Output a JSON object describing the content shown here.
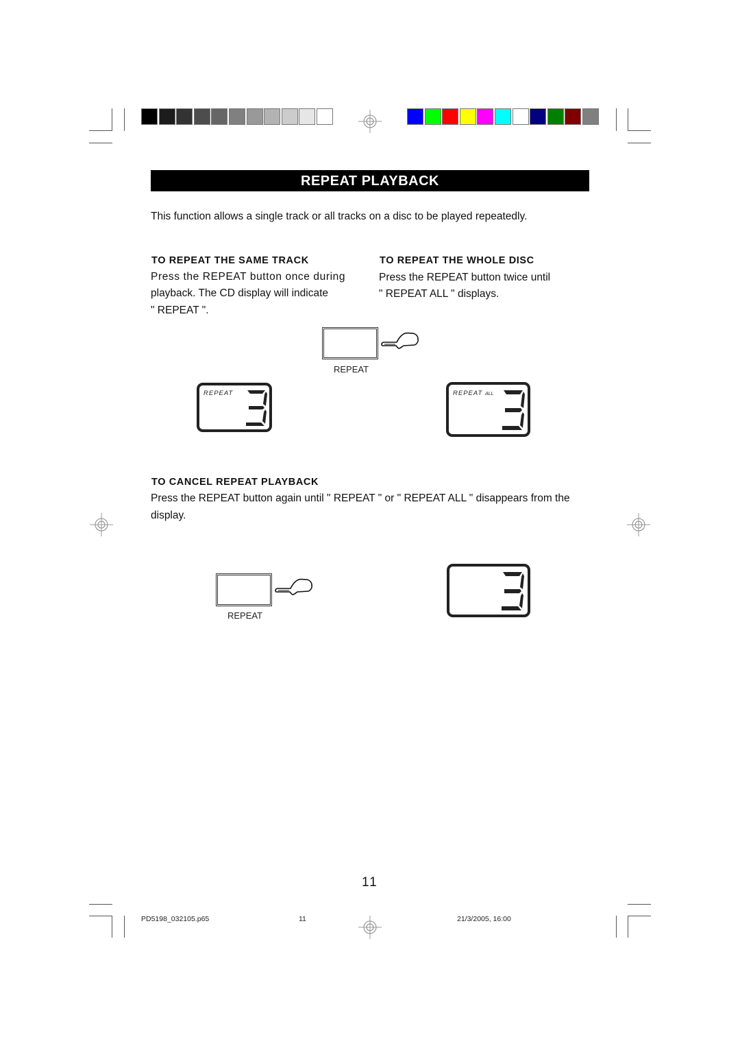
{
  "printer_marks": {
    "grayscale_swatches": [
      "#000000",
      "#1c1c1c",
      "#333333",
      "#4d4d4d",
      "#666666",
      "#808080",
      "#999999",
      "#b3b3b3",
      "#cccccc",
      "#e6e6e6",
      "#ffffff"
    ],
    "color_swatches": [
      "#0000ff",
      "#00ff00",
      "#ff0000",
      "#ffff00",
      "#ff00ff",
      "#00ffff",
      "#ffffff",
      "#000080",
      "#008000",
      "#800000",
      "#808080"
    ]
  },
  "title": "REPEAT PLAYBACK",
  "intro": "This function allows a single track or all tracks on a disc to be played repeatedly.",
  "same_track": {
    "heading": "TO REPEAT THE SAME TRACK",
    "lines": [
      "Press the REPEAT button once during",
      "playback. The CD display will indicate",
      "\" REPEAT \"."
    ]
  },
  "whole_disc": {
    "heading": "TO REPEAT THE WHOLE DISC",
    "lines": [
      "Press the REPEAT button twice until",
      "\" REPEAT ALL \"  displays."
    ]
  },
  "figure1": {
    "button_label": "REPEAT",
    "display_left": {
      "indicator": "REPEAT",
      "digit": "3"
    },
    "display_right": {
      "indicator": "REPEAT",
      "indicator_suffix": "ALL",
      "digit": "3"
    }
  },
  "cancel": {
    "heading": "TO CANCEL REPEAT PLAYBACK",
    "lines": [
      "Press the REPEAT button again until \" REPEAT \" or \" REPEAT ALL \" disappears from the",
      "display."
    ]
  },
  "figure2": {
    "button_label": "REPEAT",
    "display": {
      "digit": "3"
    }
  },
  "page_number": "11",
  "footer": {
    "file": "PD5198_032105.p65",
    "page": "11",
    "datetime": "21/3/2005, 16:00"
  }
}
